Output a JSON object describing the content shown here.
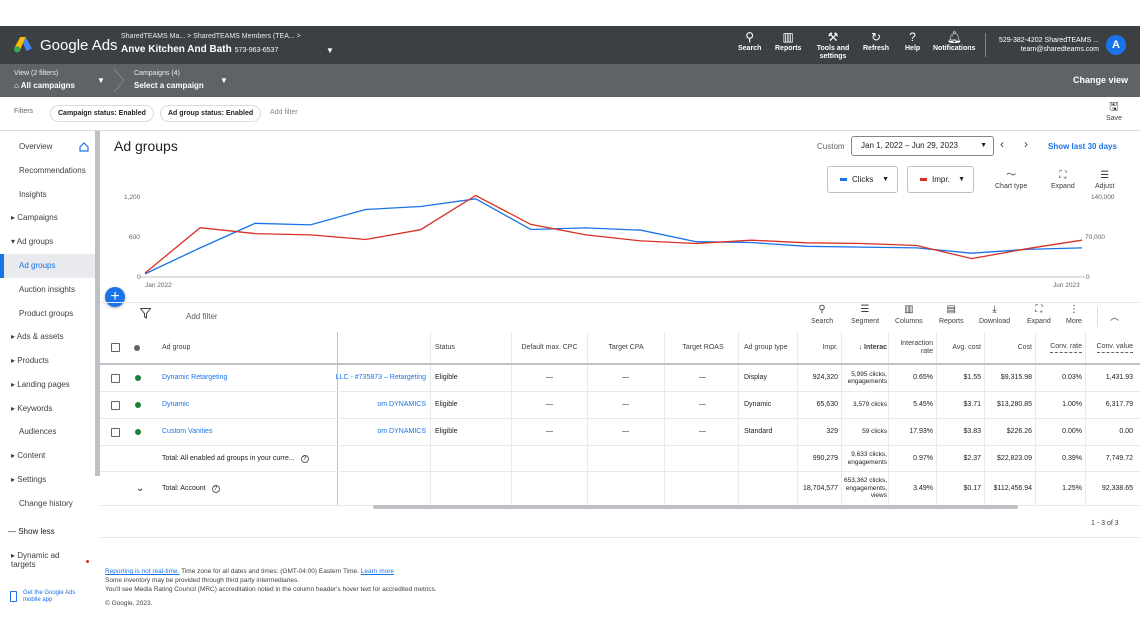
{
  "topbar": {
    "logo_text": "Google Ads",
    "breadcrumb": "SharedTEAMS Ma... > SharedTEAMS Members (TEA... >",
    "account_name": "Anve Kitchen And Bath",
    "account_phone": "573-963-6537",
    "tools": [
      {
        "label": "Search",
        "icon": "search-icon"
      },
      {
        "label": "Reports",
        "icon": "reports-icon"
      },
      {
        "label": "Tools and settings",
        "icon": "wrench-icon"
      },
      {
        "label": "Refresh",
        "icon": "refresh-icon"
      },
      {
        "label": "Help",
        "icon": "help-icon"
      },
      {
        "label": "Notifications",
        "icon": "bell-icon"
      }
    ],
    "user_id": "529-382-4202 SharedTEAMS ...",
    "user_email": "team@sharedteams.com",
    "avatar_letter": "A"
  },
  "secbar": {
    "view_sub": "View (2 filters)",
    "view_main": "All campaigns",
    "campaigns_sub": "Campaigns (4)",
    "campaigns_main": "Select a campaign",
    "change_view": "Change view"
  },
  "filterbar": {
    "label": "Filters",
    "chips": [
      "Campaign status: Enabled",
      "Ad group status: Enabled"
    ],
    "add_filter": "Add filter",
    "save": "Save"
  },
  "sidebar": {
    "items": [
      {
        "label": "Overview"
      },
      {
        "label": "Recommendations"
      },
      {
        "label": "Insights"
      },
      {
        "label": "▸ Campaigns"
      },
      {
        "label": "▾ Ad groups"
      },
      {
        "label": "Ad groups"
      },
      {
        "label": "Auction insights"
      },
      {
        "label": "Product groups"
      },
      {
        "label": "▸ Ads & assets"
      },
      {
        "label": "▸ Products"
      },
      {
        "label": "▸ Landing pages"
      },
      {
        "label": "▸ Keywords"
      },
      {
        "label": "Audiences"
      },
      {
        "label": "▸ Content"
      },
      {
        "label": "▸ Settings"
      },
      {
        "label": "Change history"
      },
      {
        "label": "— Show less"
      },
      {
        "label": "▸ Dynamic ad targets"
      }
    ],
    "mobile_app": "Get the Google Ads mobile app"
  },
  "main": {
    "title": "Ad groups",
    "custom_label": "Custom",
    "date_range": "Jan 1, 2022 – Jun 29, 2023",
    "show_last": "Show last 30 days"
  },
  "chart_controls": {
    "metric1": "Clicks",
    "metric2": "Impr.",
    "chart_type": "Chart type",
    "expand": "Expand",
    "adjust": "Adjust",
    "metric1_color": "#1a73e8",
    "metric2_color": "#d93025"
  },
  "chart_data": {
    "type": "line",
    "x_start_label": "Jan 2022",
    "x_end_label": "Jun 2023",
    "left_axis": {
      "ticks": [
        "0",
        "600",
        "1,200"
      ],
      "range": [
        0,
        1500
      ]
    },
    "right_axis": {
      "ticks": [
        "0",
        "70,000",
        "140,000"
      ],
      "range": [
        0,
        175000
      ]
    },
    "series": [
      {
        "name": "Clicks",
        "color": "#1a73e8",
        "axis": "left",
        "values": [
          40,
          380,
          700,
          680,
          880,
          920,
          1020,
          620,
          640,
          610,
          460,
          450,
          400,
          390,
          380,
          310,
          360,
          380
        ]
      },
      {
        "name": "Impr.",
        "color": "#d93025",
        "axis": "right",
        "values": [
          6000,
          75000,
          66000,
          64000,
          57000,
          72000,
          124000,
          80000,
          64000,
          55000,
          51000,
          56000,
          52000,
          51000,
          48000,
          28000,
          43000,
          56000
        ]
      }
    ]
  },
  "table_toolbar": {
    "add_filter": "Add filter",
    "tools": [
      "Search",
      "Segment",
      "Columns",
      "Reports",
      "Download",
      "Expand",
      "More"
    ]
  },
  "table": {
    "headers": {
      "ad_group": "Ad group",
      "status": "Status",
      "default_cpc": "Default max. CPC",
      "target_cpa": "Target CPA",
      "target_roas": "Target ROAS",
      "ad_group_type": "Ad group type",
      "impr": "Impr.",
      "interactions": "↓ Interac",
      "interaction_rate": "Interaction rate",
      "avg_cost": "Avg. cost",
      "cost": "Cost",
      "conv_rate": "Conv. rate",
      "conv_value": "Conv. value"
    },
    "rows": [
      {
        "name": "Dynamic Retargeting",
        "campaign": "LLC - #735873 – Retargeting",
        "status": "Eligible",
        "cpc": "—",
        "cpa": "—",
        "roas": "—",
        "type": "Display",
        "impr": "924,320",
        "interactions": "5,995 clicks, engagements",
        "rate": "0.65%",
        "avg_cost": "$1.55",
        "cost": "$9,315.98",
        "conv_rate": "0.03%",
        "conv_value": "1,431.93"
      },
      {
        "name": "Dynamic",
        "campaign": "om DYNAMICS",
        "status": "Eligible",
        "cpc": "—",
        "cpa": "—",
        "roas": "—",
        "type": "Dynamic",
        "impr": "65,630",
        "interactions": "3,579 clicks",
        "rate": "5.45%",
        "avg_cost": "$3.71",
        "cost": "$13,280.85",
        "conv_rate": "1.00%",
        "conv_value": "6,317.79"
      },
      {
        "name": "Custom Vanities",
        "campaign": "om DYNAMICS",
        "status": "Eligible",
        "cpc": "—",
        "cpa": "—",
        "roas": "—",
        "type": "Standard",
        "impr": "329",
        "interactions": "59 clicks",
        "rate": "17.93%",
        "avg_cost": "$3.83",
        "cost": "$226.26",
        "conv_rate": "0.00%",
        "conv_value": "0.00"
      }
    ],
    "total_enabled": {
      "label": "Total: All enabled ad groups in your curre...",
      "impr": "990,279",
      "interactions": "9,633 clicks, engagements",
      "rate": "0.97%",
      "avg_cost": "$2.37",
      "cost": "$22,823.09",
      "conv_rate": "0.39%",
      "conv_value": "7,749.72"
    },
    "total_account": {
      "label": "Total: Account",
      "impr": "18,704,577",
      "interactions": "653,362 clicks, engagements, views",
      "rate": "3.49%",
      "avg_cost": "$0.17",
      "cost": "$112,456.94",
      "conv_rate": "1.25%",
      "conv_value": "92,338.65"
    },
    "pagination": "1 - 3 of 3"
  },
  "footer": {
    "not_realtime": "Reporting is not real-time.",
    "timezone": " Time zone for all dates and times: (GMT-04:00) Eastern Time. ",
    "learn_more": "Learn more",
    "third_party": "Some inventory may be provided through third party intermediaries.",
    "mrc": "You'll see Media Rating Council (MRC) accreditation noted in the column header's hover text for accredited metrics.",
    "copyright": "© Google, 2023."
  }
}
